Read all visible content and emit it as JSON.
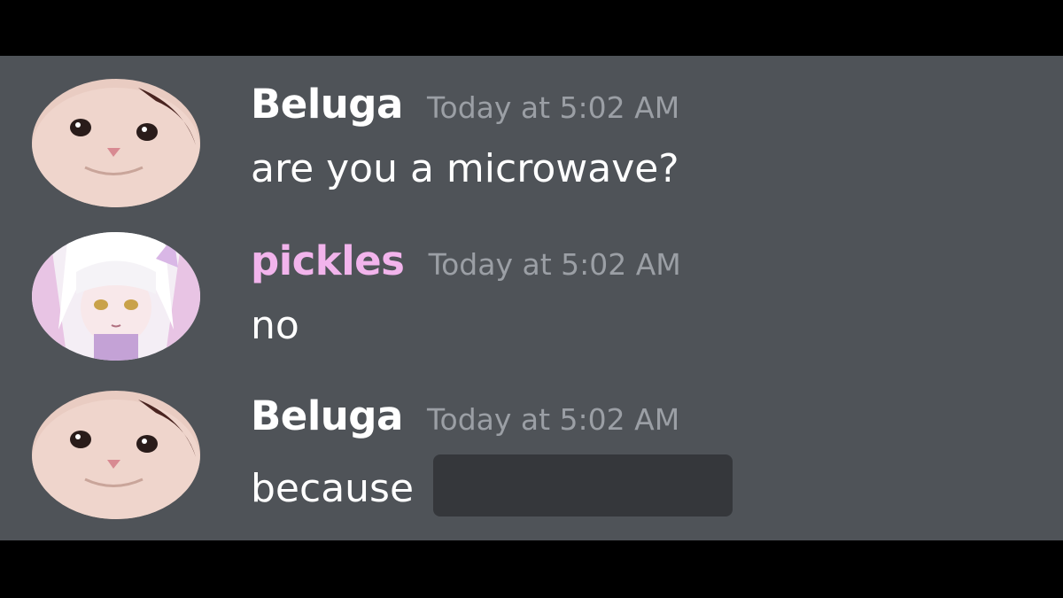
{
  "messages": [
    {
      "author": "Beluga",
      "author_color": "#ffffff",
      "timestamp": "Today at 5:02 AM",
      "text": "are you a microwave?",
      "avatar_icon": "cat-avatar-icon"
    },
    {
      "author": "pickles",
      "author_color": "#f2b4ec",
      "timestamp": "Today at 5:02 AM",
      "text": "no",
      "avatar_icon": "anime-girl-avatar-icon"
    },
    {
      "author": "Beluga",
      "author_color": "#ffffff",
      "timestamp": "Today at 5:02 AM",
      "text": "because",
      "has_spoiler": true,
      "avatar_icon": "cat-avatar-icon"
    }
  ],
  "colors": {
    "chat_background": "#4f5358",
    "letterbox": "#000000",
    "timestamp": "#9b9fa5",
    "spoiler": "#35373b"
  }
}
